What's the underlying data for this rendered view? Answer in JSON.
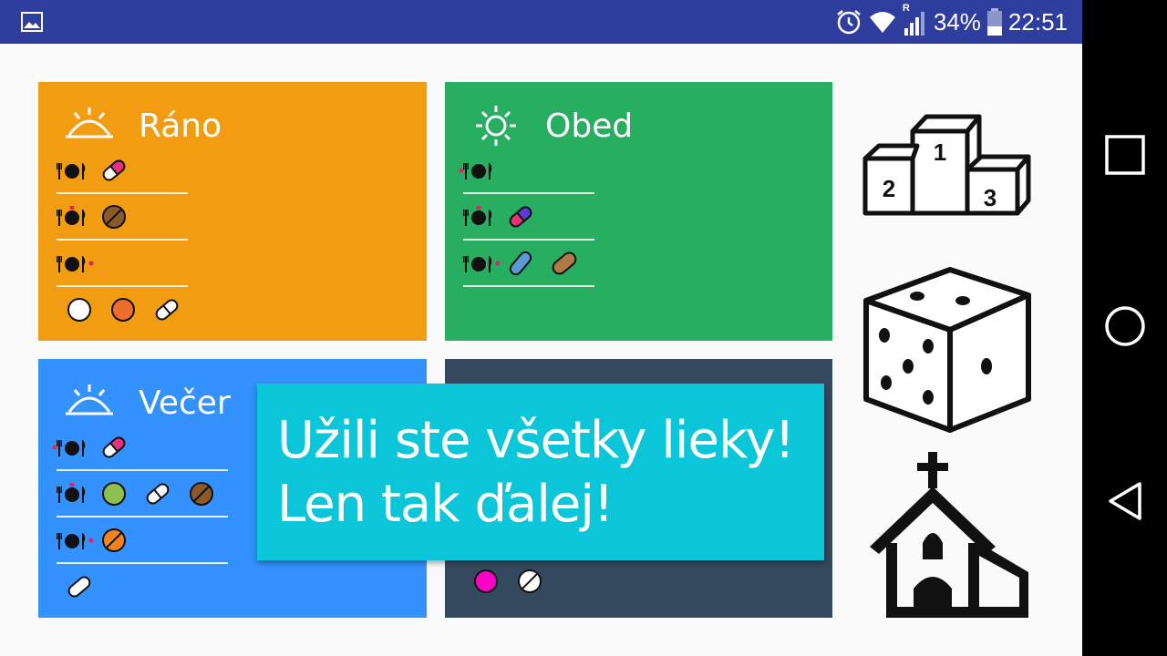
{
  "status_bar": {
    "battery_percent": "34%",
    "time": "22:51",
    "signal_letter": "R",
    "icons": [
      "gallery-icon",
      "alarm-icon",
      "wifi-icon",
      "signal-icon",
      "battery-icon"
    ]
  },
  "cards": [
    {
      "id": "rano",
      "title": "Ráno",
      "color": "#f29c12",
      "icon": "sunrise-icon"
    },
    {
      "id": "obed",
      "title": "Obed",
      "color": "#27ae60",
      "icon": "sun-icon"
    },
    {
      "id": "vecer",
      "title": "Večer",
      "color": "#3392fd",
      "icon": "sunset-icon"
    },
    {
      "id": "noc",
      "title": "",
      "color": "#34495e",
      "icon": "moon-icon"
    }
  ],
  "toast": {
    "line1": "Užili ste všetky lieky!",
    "line2": "Len tak ďalej!"
  },
  "side_icons": [
    "podium-icon",
    "dice-icon",
    "church-icon"
  ],
  "nav": [
    "recent-apps-icon",
    "home-icon",
    "back-icon"
  ],
  "colors": {
    "status_bar": "#2f3e9e",
    "toast": "#0bc6d8",
    "dot": "#e0245e"
  }
}
